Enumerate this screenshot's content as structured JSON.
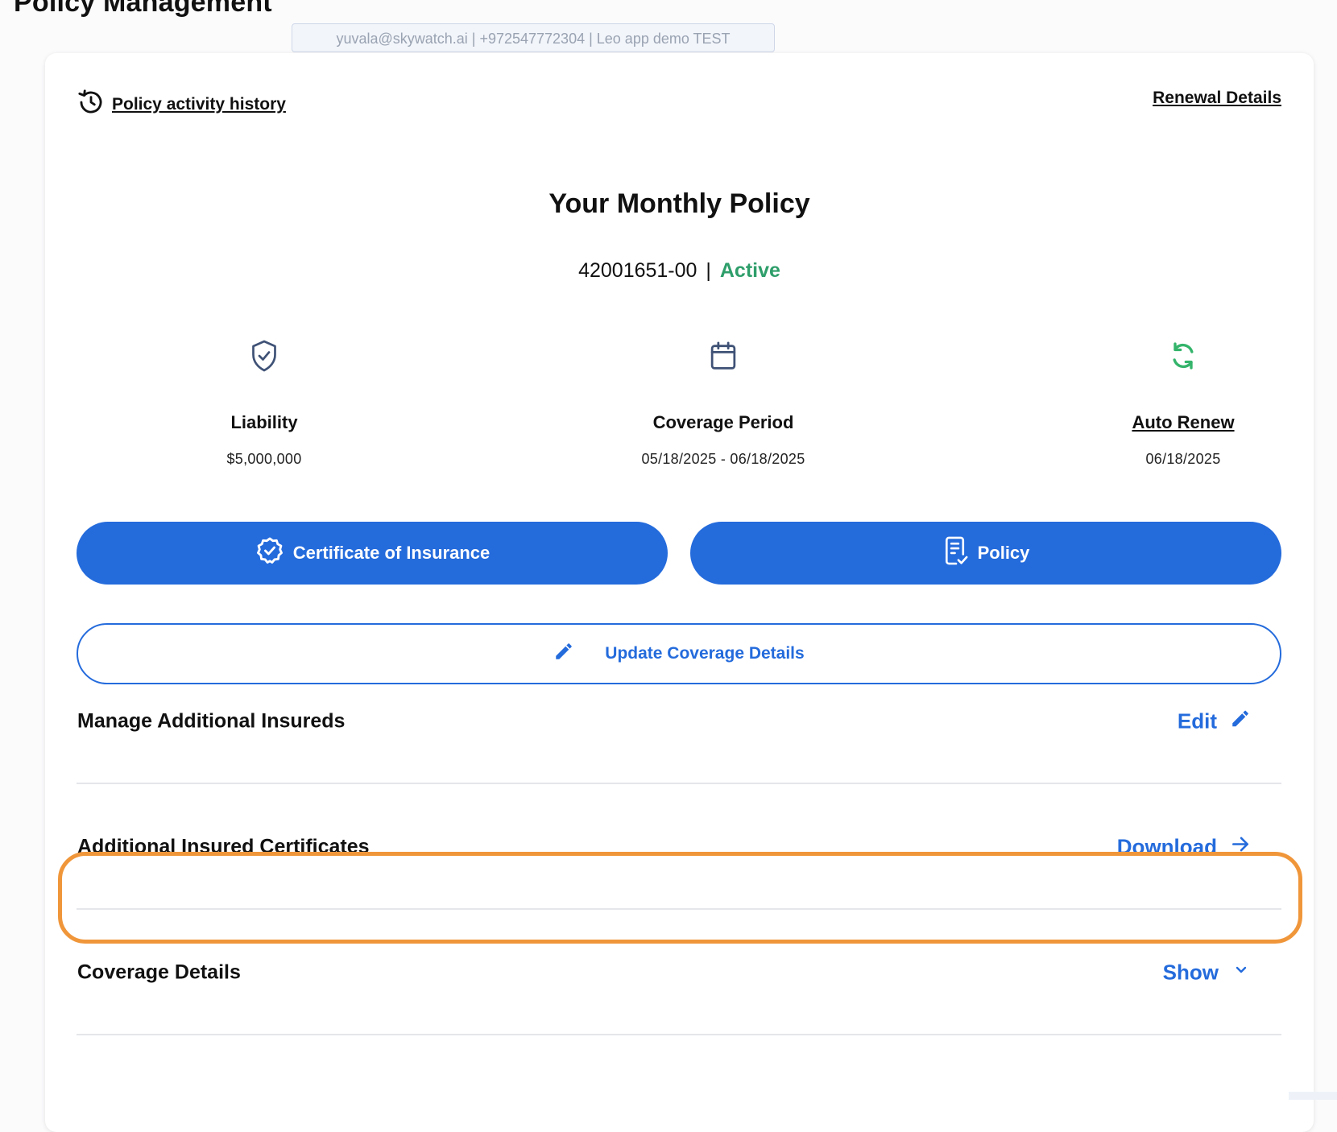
{
  "page": {
    "title": "Policy Management"
  },
  "banner": {
    "text": "yuvala@skywatch.ai | +972547772304 | Leo app demo TEST"
  },
  "links": {
    "history": "Policy activity history",
    "renewal": "Renewal Details"
  },
  "policy": {
    "title": "Your Monthly Policy",
    "number": "42001651-00",
    "separator": "|",
    "status": "Active",
    "status_color": "#2e9e6a"
  },
  "stats": {
    "liability": {
      "label": "Liability",
      "value": "$5,000,000",
      "icon": "shield-check-icon"
    },
    "coverage": {
      "label": "Coverage Period",
      "value": "05/18/2025 - 06/18/2025",
      "icon": "calendar-icon"
    },
    "renew": {
      "label": "Auto Renew",
      "value": "06/18/2025",
      "icon": "refresh-icon"
    }
  },
  "buttons": {
    "coi": "Certificate of Insurance",
    "policy": "Policy",
    "update": "Update Coverage Details"
  },
  "rows": {
    "manage": {
      "label": "Manage Additional Insureds",
      "action": "Edit"
    },
    "certs": {
      "label": "Additional Insured Certificates",
      "action": "Download"
    },
    "coverage": {
      "label": "Coverage Details",
      "action": "Show"
    }
  },
  "colors": {
    "primary": "#246bdc",
    "highlight": "#f0963a",
    "active": "#2e9e6a"
  }
}
